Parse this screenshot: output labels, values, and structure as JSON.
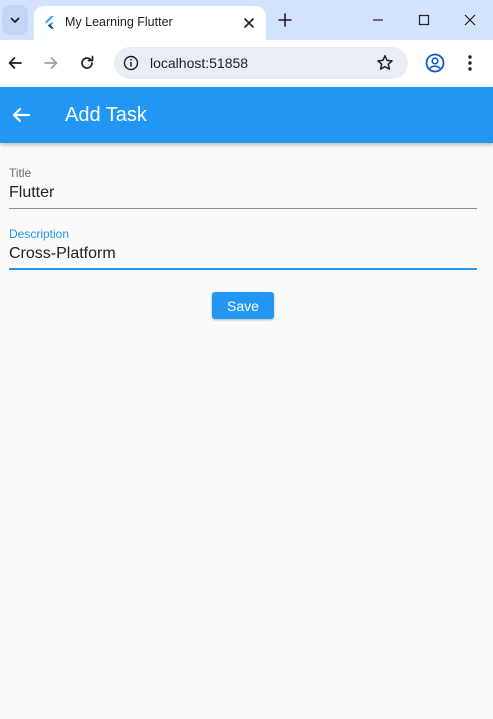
{
  "browser": {
    "tab_title": "My Learning Flutter",
    "url": "localhost:51858"
  },
  "app": {
    "appbar_title": "Add Task",
    "primary_color": "#2196f3",
    "form": {
      "title_label": "Title",
      "title_value": "Flutter",
      "description_label": "Description",
      "description_value": "Cross-Platform",
      "save_label": "Save"
    }
  },
  "icons": {
    "tab_search": "chevron-down-icon",
    "favicon": "flutter-icon",
    "tab_close": "close-icon",
    "new_tab": "plus-icon",
    "minimize": "minimize-icon",
    "maximize": "maximize-icon",
    "close_window": "close-icon",
    "back": "arrow-left-icon",
    "forward": "arrow-right-icon",
    "reload": "reload-icon",
    "site_info": "info-icon",
    "bookmark": "star-icon",
    "profile": "profile-icon",
    "menu": "more-vert-icon",
    "appbar_back": "arrow-left-icon"
  }
}
